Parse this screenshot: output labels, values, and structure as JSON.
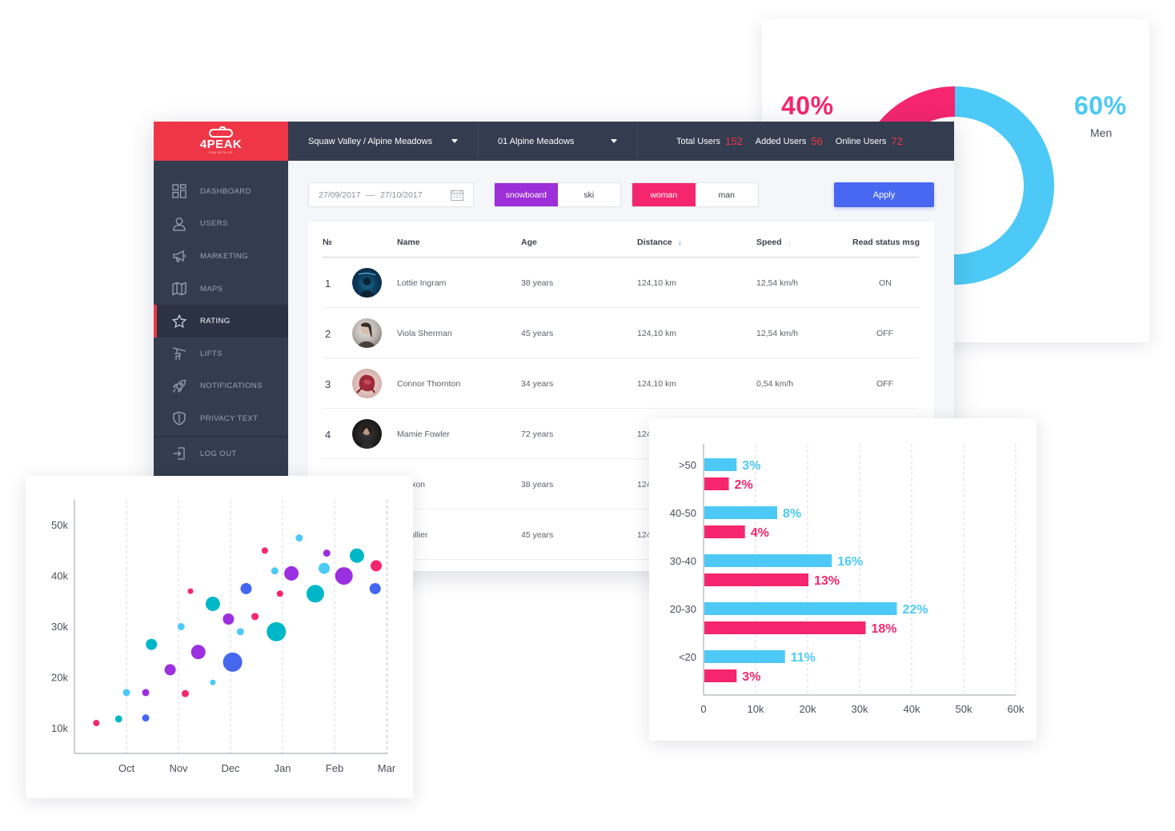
{
  "gender_donut": {
    "women_pct": "40%",
    "men_pct": "60%",
    "men_label": "Men",
    "women_value": 40,
    "men_value": 60,
    "colors": {
      "women": "#f5266e",
      "men": "#4cc9f6"
    }
  },
  "app": {
    "logo_text": "4PEAK",
    "logo_sub": "FUN WITH US",
    "brand_color": "#ee3647"
  },
  "sidebar": {
    "items": [
      {
        "label": "DASHBOARD",
        "icon": "dashboard-icon"
      },
      {
        "label": "USERS",
        "icon": "user-icon"
      },
      {
        "label": "MARKETING",
        "icon": "megaphone-icon"
      },
      {
        "label": "MAPS",
        "icon": "map-icon"
      },
      {
        "label": "RATING",
        "icon": "star-icon",
        "active": true
      },
      {
        "label": "LIFTS",
        "icon": "lift-icon"
      },
      {
        "label": "NOTIFICATIONS",
        "icon": "rocket-icon"
      },
      {
        "label": "PRIVACY TEXT",
        "icon": "shield-icon"
      }
    ],
    "logout_label": "LOG OUT"
  },
  "topbar": {
    "resort_select": "Squaw Valley / Alpine Meadows",
    "area_select": "01 Alpine Meadows",
    "stats": [
      {
        "label": "Total Users",
        "value": "152"
      },
      {
        "label": "Added Users",
        "value": "56"
      },
      {
        "label": "Online Users",
        "value": "72"
      }
    ]
  },
  "filters": {
    "date_from": "27/09/2017",
    "date_sep": "—",
    "date_to": "27/10/2017",
    "sport": {
      "selected": "snowboard",
      "other": "ski"
    },
    "gender": {
      "selected": "woman",
      "other": "man"
    },
    "apply_label": "Apply"
  },
  "table": {
    "headers": {
      "num": "№",
      "name": "Name",
      "age": "Age",
      "distance": "Distance",
      "speed": "Speed",
      "status": "Read status msg"
    },
    "rows": [
      {
        "num": "1",
        "name": "Lottie Ingram",
        "age": "38 years",
        "distance": "124,10 km",
        "speed": "12,54 km/h",
        "status": "ON"
      },
      {
        "num": "2",
        "name": "Viola Sherman",
        "age": "45 years",
        "distance": "124,10 km",
        "speed": "12,54 km/h",
        "status": "OFF"
      },
      {
        "num": "3",
        "name": "Connor Thornton",
        "age": "34 years",
        "distance": "124,10 km",
        "speed": "0,54 km/h",
        "status": "OFF"
      },
      {
        "num": "4",
        "name": "Mamie Fowler",
        "age": "72 years",
        "distance": "124,10 km",
        "speed": "",
        "status": ""
      },
      {
        "num": "5",
        "name": "y Dixon",
        "age": "38 years",
        "distance": "124",
        "speed": "",
        "status": ""
      },
      {
        "num": "6",
        "name": "a Collier",
        "age": "45 years",
        "distance": "124",
        "speed": "",
        "status": ""
      }
    ]
  },
  "chart_data": [
    {
      "type": "scatter",
      "x_ticks": [
        "Oct",
        "Nov",
        "Dec",
        "Jan",
        "Feb",
        "Mar"
      ],
      "y_ticks": [
        "10k",
        "20k",
        "30k",
        "40k",
        "50k"
      ],
      "ylim": [
        5000,
        55000
      ],
      "grid": "vertical dashed",
      "colors": {
        "pink": "#f5266e",
        "cyan": "#00b7c7",
        "purple": "#9b30e0",
        "blue": "#4566ee",
        "light_blue": "#4cc9f6"
      },
      "points": [
        {
          "month": -0.58,
          "y": 11000,
          "r": 4,
          "c": "pink"
        },
        {
          "month": -0.15,
          "y": 11800,
          "r": 4.5,
          "c": "cyan"
        },
        {
          "month": 0.0,
          "y": 17000,
          "r": 4.5,
          "c": "light_blue"
        },
        {
          "month": 0.37,
          "y": 12000,
          "r": 4.5,
          "c": "blue"
        },
        {
          "month": 0.37,
          "y": 17000,
          "r": 4.5,
          "c": "purple"
        },
        {
          "month": 0.48,
          "y": 26500,
          "r": 7,
          "c": "cyan"
        },
        {
          "month": 0.84,
          "y": 21500,
          "r": 7,
          "c": "purple"
        },
        {
          "month": 1.05,
          "y": 30000,
          "r": 4.5,
          "c": "light_blue"
        },
        {
          "month": 1.13,
          "y": 16800,
          "r": 4.5,
          "c": "pink"
        },
        {
          "month": 1.23,
          "y": 37000,
          "r": 3.5,
          "c": "pink"
        },
        {
          "month": 1.38,
          "y": 25000,
          "r": 9,
          "c": "purple"
        },
        {
          "month": 1.66,
          "y": 34500,
          "r": 9,
          "c": "cyan"
        },
        {
          "month": 1.66,
          "y": 19000,
          "r": 3.5,
          "c": "light_blue"
        },
        {
          "month": 1.96,
          "y": 31500,
          "r": 7,
          "c": "purple"
        },
        {
          "month": 2.04,
          "y": 23000,
          "r": 12,
          "c": "blue"
        },
        {
          "month": 2.19,
          "y": 29000,
          "r": 4.5,
          "c": "light_blue"
        },
        {
          "month": 2.3,
          "y": 37500,
          "r": 7,
          "c": "blue"
        },
        {
          "month": 2.47,
          "y": 32000,
          "r": 4.5,
          "c": "pink"
        },
        {
          "month": 2.66,
          "y": 45000,
          "r": 4,
          "c": "pink"
        },
        {
          "month": 2.85,
          "y": 41000,
          "r": 4.5,
          "c": "light_blue"
        },
        {
          "month": 2.88,
          "y": 29000,
          "r": 12,
          "c": "cyan"
        },
        {
          "month": 2.95,
          "y": 36500,
          "r": 4,
          "c": "pink"
        },
        {
          "month": 3.17,
          "y": 40500,
          "r": 9,
          "c": "purple"
        },
        {
          "month": 3.32,
          "y": 47500,
          "r": 4.5,
          "c": "light_blue"
        },
        {
          "month": 3.63,
          "y": 36500,
          "r": 11,
          "c": "cyan"
        },
        {
          "month": 3.8,
          "y": 41500,
          "r": 7,
          "c": "light_blue"
        },
        {
          "month": 3.85,
          "y": 44500,
          "r": 4.5,
          "c": "purple"
        },
        {
          "month": 4.18,
          "y": 40000,
          "r": 11,
          "c": "purple"
        },
        {
          "month": 4.43,
          "y": 44000,
          "r": 9,
          "c": "cyan"
        },
        {
          "month": 4.8,
          "y": 42000,
          "r": 7,
          "c": "pink"
        },
        {
          "month": 4.78,
          "y": 37500,
          "r": 7,
          "c": "blue"
        }
      ]
    },
    {
      "type": "bar",
      "orientation": "horizontal",
      "categories": [
        ">50",
        "40-50",
        "30-40",
        "20-30",
        "<20"
      ],
      "x_ticks": [
        "0",
        "10k",
        "20k",
        "30k",
        "40k",
        "50k",
        "60k"
      ],
      "xlim": [
        0,
        60000
      ],
      "grid": "vertical dashed",
      "series": [
        {
          "color": "#4cc9f6",
          "values": [
            6200,
            14000,
            24500,
            37000,
            15500
          ],
          "labels": [
            "3%",
            "8%",
            "16%",
            "22%",
            "11%"
          ]
        },
        {
          "color": "#f5266e",
          "values": [
            4700,
            7800,
            20000,
            31000,
            6200
          ],
          "labels": [
            "2%",
            "4%",
            "13%",
            "18%",
            "3%"
          ]
        }
      ]
    }
  ]
}
